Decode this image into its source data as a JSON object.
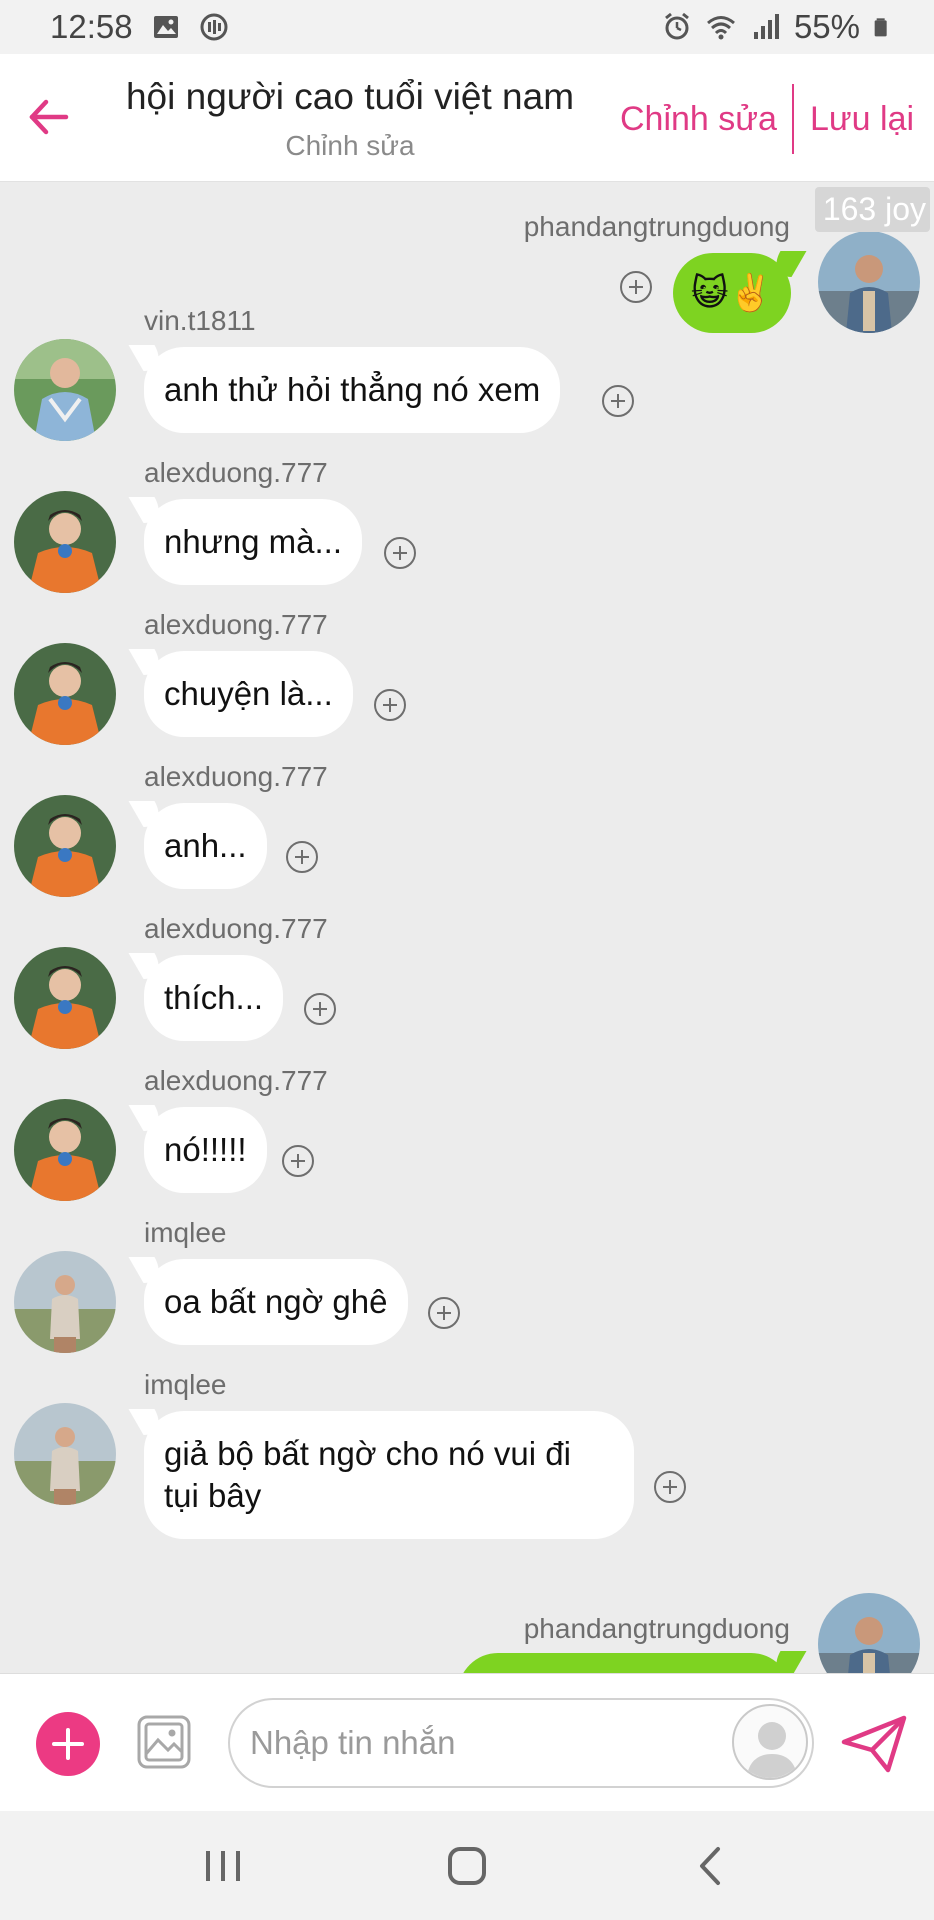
{
  "status_bar": {
    "time": "12:58",
    "battery": "55%"
  },
  "header": {
    "title": "hội người cao tuổi việt nam",
    "subtitle": "Chỉnh sửa",
    "edit_label": "Chỉnh sửa",
    "save_label": "Lưu lại"
  },
  "joy_badge": "163 joy",
  "messages": [
    {
      "user": "phandangtrungduong",
      "text": "😺✌️",
      "side": "right"
    },
    {
      "user": "vin.t1811",
      "text": "anh thử hỏi thẳng nó xem",
      "side": "left"
    },
    {
      "user": "alexduong.777",
      "text": "nhưng mà...",
      "side": "left"
    },
    {
      "user": "alexduong.777",
      "text": "chuyện là...",
      "side": "left"
    },
    {
      "user": "alexduong.777",
      "text": "anh...",
      "side": "left"
    },
    {
      "user": "alexduong.777",
      "text": "thích...",
      "side": "left"
    },
    {
      "user": "alexduong.777",
      "text": "nó!!!!!",
      "side": "left"
    },
    {
      "user": "imqlee",
      "text": "oa bất ngờ ghê",
      "side": "left"
    },
    {
      "user": "imqlee",
      "text": "giả bộ bất ngờ cho nó vui đi tụi bây",
      "side": "left"
    },
    {
      "user": "phandangtrungduong",
      "text": "",
      "side": "right"
    }
  ],
  "input": {
    "placeholder": "Nhập tin nhắn"
  },
  "colors": {
    "accent": "#e03a85",
    "sent_bubble": "#7ed321",
    "background": "#ececec"
  },
  "icons": [
    "back-arrow-icon",
    "plus-icon",
    "image-icon",
    "sticker-avatar-icon",
    "send-icon",
    "recents-icon",
    "home-icon",
    "nav-back-icon"
  ]
}
